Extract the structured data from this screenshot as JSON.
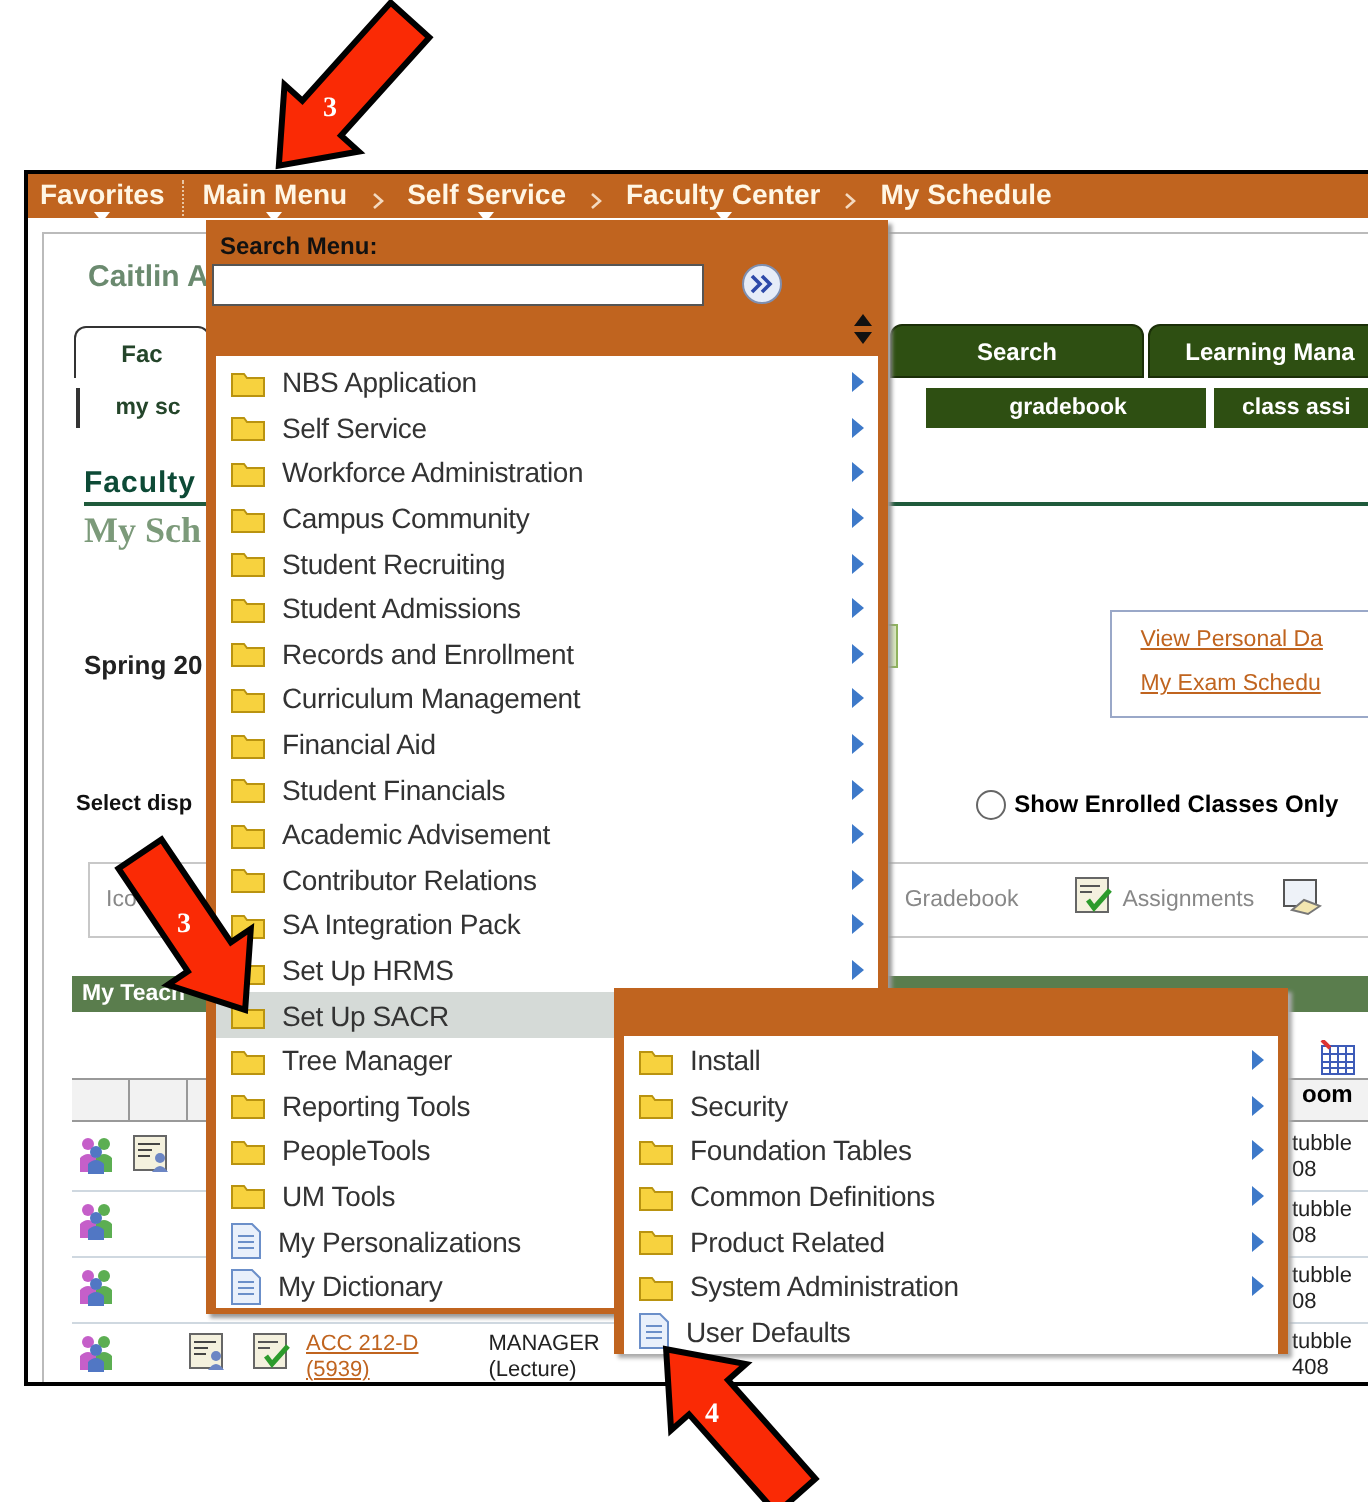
{
  "nav": [
    {
      "label": "Favorites",
      "dropdown": true
    },
    {
      "label": "Main Menu",
      "dropdown": true
    },
    {
      "label": "Self Service",
      "dropdown": true
    },
    {
      "label": "Faculty Center",
      "dropdown": true
    },
    {
      "label": "My Schedule",
      "dropdown": false
    }
  ],
  "page": {
    "user_name": "Caitlin A",
    "tabs": [
      {
        "label": "Fac",
        "selected": true
      },
      {
        "label": "Search",
        "selected": false
      },
      {
        "label": "Learning Mana",
        "selected": false
      }
    ],
    "subtabs": [
      {
        "label": "my sc",
        "selected": true
      },
      {
        "label": "gradebook",
        "selected": false
      },
      {
        "label": "class assi",
        "selected": false
      }
    ],
    "heading": "Faculty",
    "subheading": "My Sch",
    "term": "Spring 20",
    "links": [
      "View Personal Da",
      "My Exam Schedu"
    ],
    "select_label": "Select disp",
    "radio": {
      "label": "Show Enrolled Classes Only",
      "selected": false
    },
    "toolbar": [
      {
        "label": "Ico",
        "kind": "plain"
      },
      {
        "label": "Gradebook",
        "kind": "plain"
      },
      {
        "label": "Assignments",
        "kind": "icon"
      }
    ],
    "section_title": "My Teach",
    "column_heading": "oom",
    "rows": [
      {
        "room": [
          "tubble",
          "08"
        ]
      },
      {
        "room": [
          "tubble",
          "08"
        ]
      },
      {
        "room": [
          "tubble",
          "08"
        ]
      },
      {
        "course": "ACC 212-D",
        "section": "(5939)",
        "title": "MANAGER",
        "component": "(Lecture)",
        "room": [
          "tubble",
          "408"
        ]
      }
    ]
  },
  "main_menu": {
    "search_label": "Search Menu:",
    "items": [
      {
        "label": "NBS Application",
        "kind": "folder",
        "selected": false
      },
      {
        "label": "Self Service",
        "kind": "folder",
        "selected": false
      },
      {
        "label": "Workforce Administration",
        "kind": "folder",
        "selected": false
      },
      {
        "label": "Campus Community",
        "kind": "folder",
        "selected": false
      },
      {
        "label": "Student Recruiting",
        "kind": "folder",
        "selected": false
      },
      {
        "label": "Student Admissions",
        "kind": "folder",
        "selected": false
      },
      {
        "label": "Records and Enrollment",
        "kind": "folder",
        "selected": false
      },
      {
        "label": "Curriculum Management",
        "kind": "folder",
        "selected": false
      },
      {
        "label": "Financial Aid",
        "kind": "folder",
        "selected": false
      },
      {
        "label": "Student Financials",
        "kind": "folder",
        "selected": false
      },
      {
        "label": "Academic Advisement",
        "kind": "folder",
        "selected": false
      },
      {
        "label": "Contributor Relations",
        "kind": "folder",
        "selected": false
      },
      {
        "label": "SA Integration Pack",
        "kind": "folder",
        "selected": false
      },
      {
        "label": "Set Up HRMS",
        "kind": "folder",
        "selected": false
      },
      {
        "label": "Set Up SACR",
        "kind": "folder",
        "selected": true
      },
      {
        "label": "Tree Manager",
        "kind": "folder",
        "selected": false
      },
      {
        "label": "Reporting Tools",
        "kind": "folder",
        "selected": false
      },
      {
        "label": "PeopleTools",
        "kind": "folder",
        "selected": false
      },
      {
        "label": "UM Tools",
        "kind": "folder",
        "selected": false
      },
      {
        "label": "My Personalizations",
        "kind": "page",
        "selected": false
      },
      {
        "label": "My Dictionary",
        "kind": "page",
        "selected": false
      }
    ]
  },
  "submenu": {
    "items": [
      {
        "label": "Install",
        "kind": "folder",
        "selected": false
      },
      {
        "label": "Security",
        "kind": "folder",
        "selected": false
      },
      {
        "label": "Foundation Tables",
        "kind": "folder",
        "selected": false
      },
      {
        "label": "Common Definitions",
        "kind": "folder",
        "selected": false
      },
      {
        "label": "Product Related",
        "kind": "folder",
        "selected": false
      },
      {
        "label": "System Administration",
        "kind": "folder",
        "selected": false
      },
      {
        "label": "User Defaults",
        "kind": "page",
        "selected": false
      }
    ]
  },
  "callouts": [
    {
      "number": "3"
    },
    {
      "number": "3"
    },
    {
      "number": "4"
    }
  ]
}
